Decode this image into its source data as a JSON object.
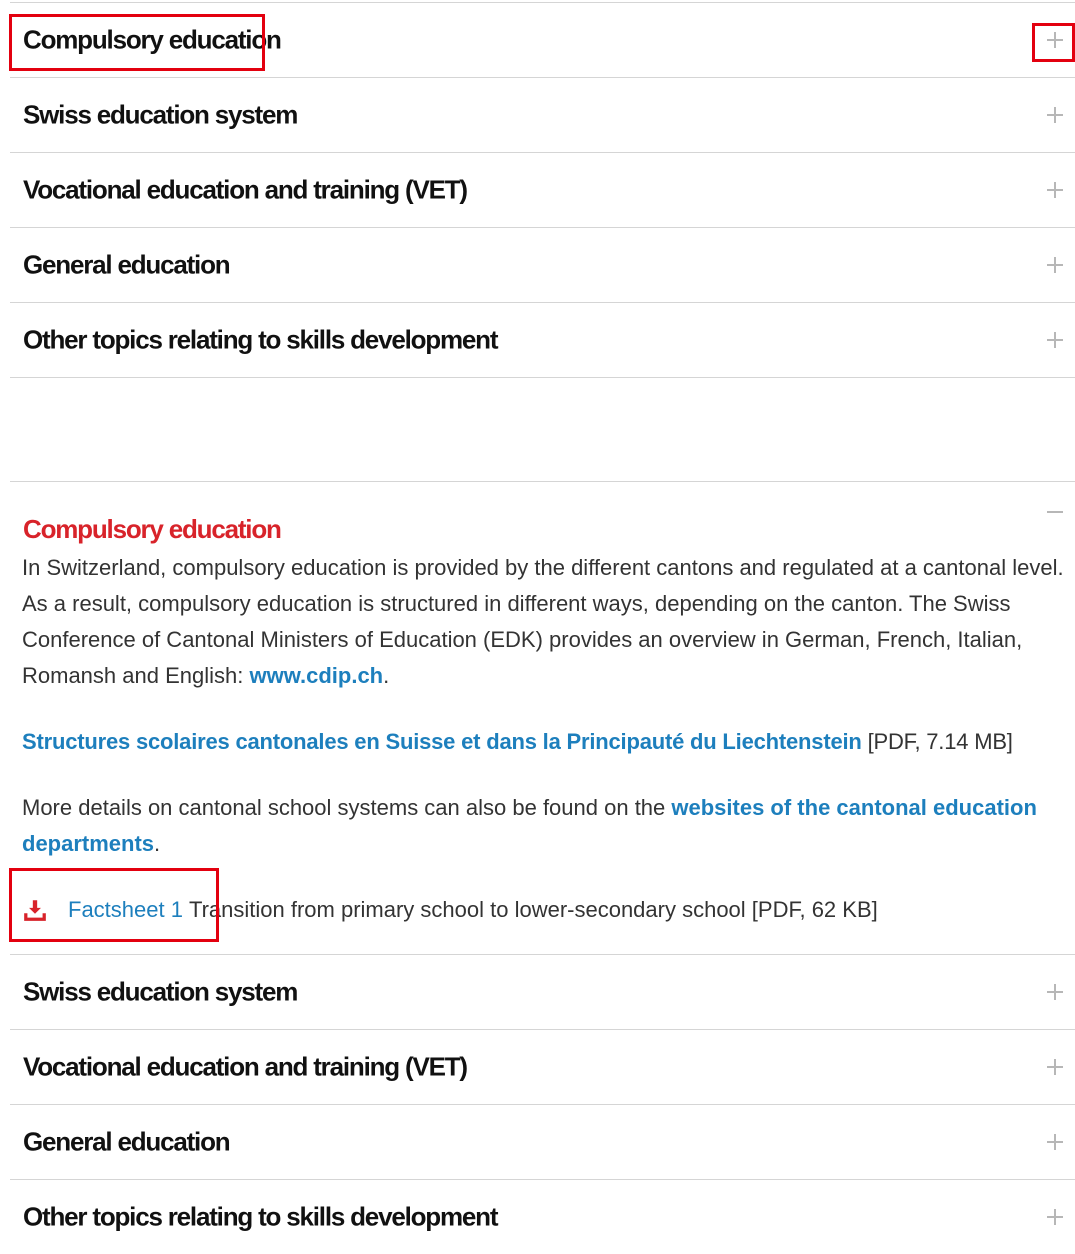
{
  "accordion_top": {
    "items": [
      {
        "label": "Compulsory education",
        "state": "collapsed"
      },
      {
        "label": "Swiss education system",
        "state": "collapsed"
      },
      {
        "label": "Vocational education and training (VET)",
        "state": "collapsed"
      },
      {
        "label": "General education",
        "state": "collapsed"
      },
      {
        "label": "Other topics relating to skills development",
        "state": "collapsed"
      }
    ]
  },
  "accordion_bottom": {
    "open_item": {
      "label": "Compulsory education",
      "paragraph1_text": "In Switzerland, compulsory education is provided by the different cantons and regulated at a cantonal level. As a result, compulsory education is structured in different ways, depending on the canton. The Swiss Conference of Cantonal Ministers of Education (EDK) provides an overview in German, French, Italian, Romansh and English: ",
      "paragraph1_link": "www.cdip.ch",
      "paragraph1_end": ".",
      "paragraph2_link": "Structures scolaires cantonales en Suisse et dans la Principauté du Liechtenstein",
      "paragraph2_meta": " [PDF, 7.14 MB]",
      "paragraph3_text": "More details on cantonal school systems can also be found on the ",
      "paragraph3_link": "websites of the cantonal education departments",
      "paragraph3_end": ".",
      "factsheet_link": "Factsheet 1",
      "factsheet_text": "Transition from primary school to lower-secondary school [PDF, 62 KB]",
      "download_icon": "download-icon"
    },
    "items": [
      {
        "label": "Swiss education system",
        "state": "collapsed"
      },
      {
        "label": "Vocational education and training (VET)",
        "state": "collapsed"
      },
      {
        "label": "General education",
        "state": "collapsed"
      },
      {
        "label": "Other topics relating to skills development",
        "state": "collapsed"
      }
    ]
  },
  "colors": {
    "accent_red": "#d8232a",
    "link_blue": "#1d7fbd",
    "highlight_red": "#e3000f",
    "divider": "#d5d5d5"
  }
}
